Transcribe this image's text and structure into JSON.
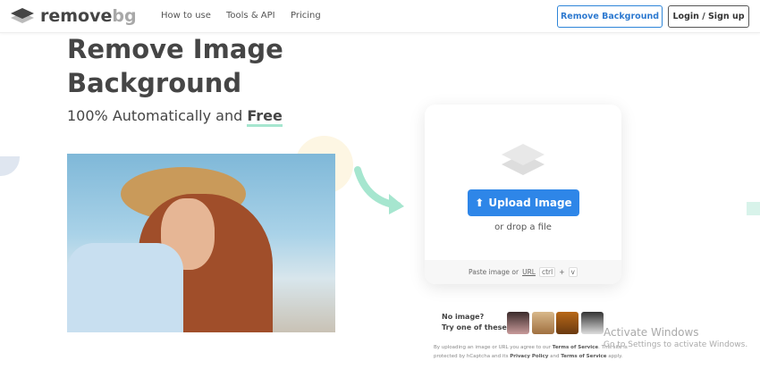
{
  "header": {
    "logo_main": "remove",
    "logo_suffix": "bg",
    "nav": [
      "How to use",
      "Tools & API",
      "Pricing"
    ],
    "remove_background": "Remove Background",
    "login": "Login / Sign up"
  },
  "hero": {
    "title": "Remove Image Background",
    "subtitle_prefix": "100% Automatically and",
    "subtitle_emph": "Free"
  },
  "upload": {
    "button": "Upload Image",
    "drop": "or drop a file",
    "paste_prefix": "Paste image or",
    "paste_link": "URL",
    "key1": "ctrl",
    "plus": "+",
    "key2": "v"
  },
  "samples": {
    "line1": "No image?",
    "line2": "Try one of these:"
  },
  "legal": {
    "t1": "By uploading an image or URL you agree to our",
    "tos": "Terms of Service",
    "t2": ". This site is protected by hCaptcha and its",
    "privacy": "Privacy Policy",
    "t3": "and",
    "tos2": "Terms of Service",
    "t4": "apply."
  },
  "watermark": {
    "title": "Activate Windows",
    "sub": "Go to Settings to activate Windows."
  }
}
